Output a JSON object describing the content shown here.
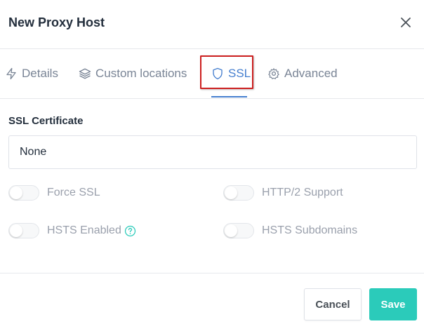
{
  "modal": {
    "title": "New Proxy Host"
  },
  "tabs": [
    {
      "label": "Details",
      "icon": "lightning-icon",
      "active": false
    },
    {
      "label": "Custom locations",
      "icon": "layers-icon",
      "active": false
    },
    {
      "label": "SSL",
      "icon": "shield-icon",
      "active": true
    },
    {
      "label": "Advanced",
      "icon": "gear-icon",
      "active": false
    }
  ],
  "ssl": {
    "certificate_label": "SSL Certificate",
    "certificate_value": "None",
    "toggles": [
      {
        "label": "Force SSL",
        "on": false
      },
      {
        "label": "HTTP/2 Support",
        "on": false
      },
      {
        "label": "HSTS Enabled",
        "on": false,
        "help_icon": "question-circle-icon"
      },
      {
        "label": "HSTS Subdomains",
        "on": false
      }
    ]
  },
  "footer": {
    "cancel_label": "Cancel",
    "save_label": "Save"
  },
  "colors": {
    "accent": "#467fcf",
    "save": "#2bcbba",
    "highlight": "#cc1f1f"
  }
}
